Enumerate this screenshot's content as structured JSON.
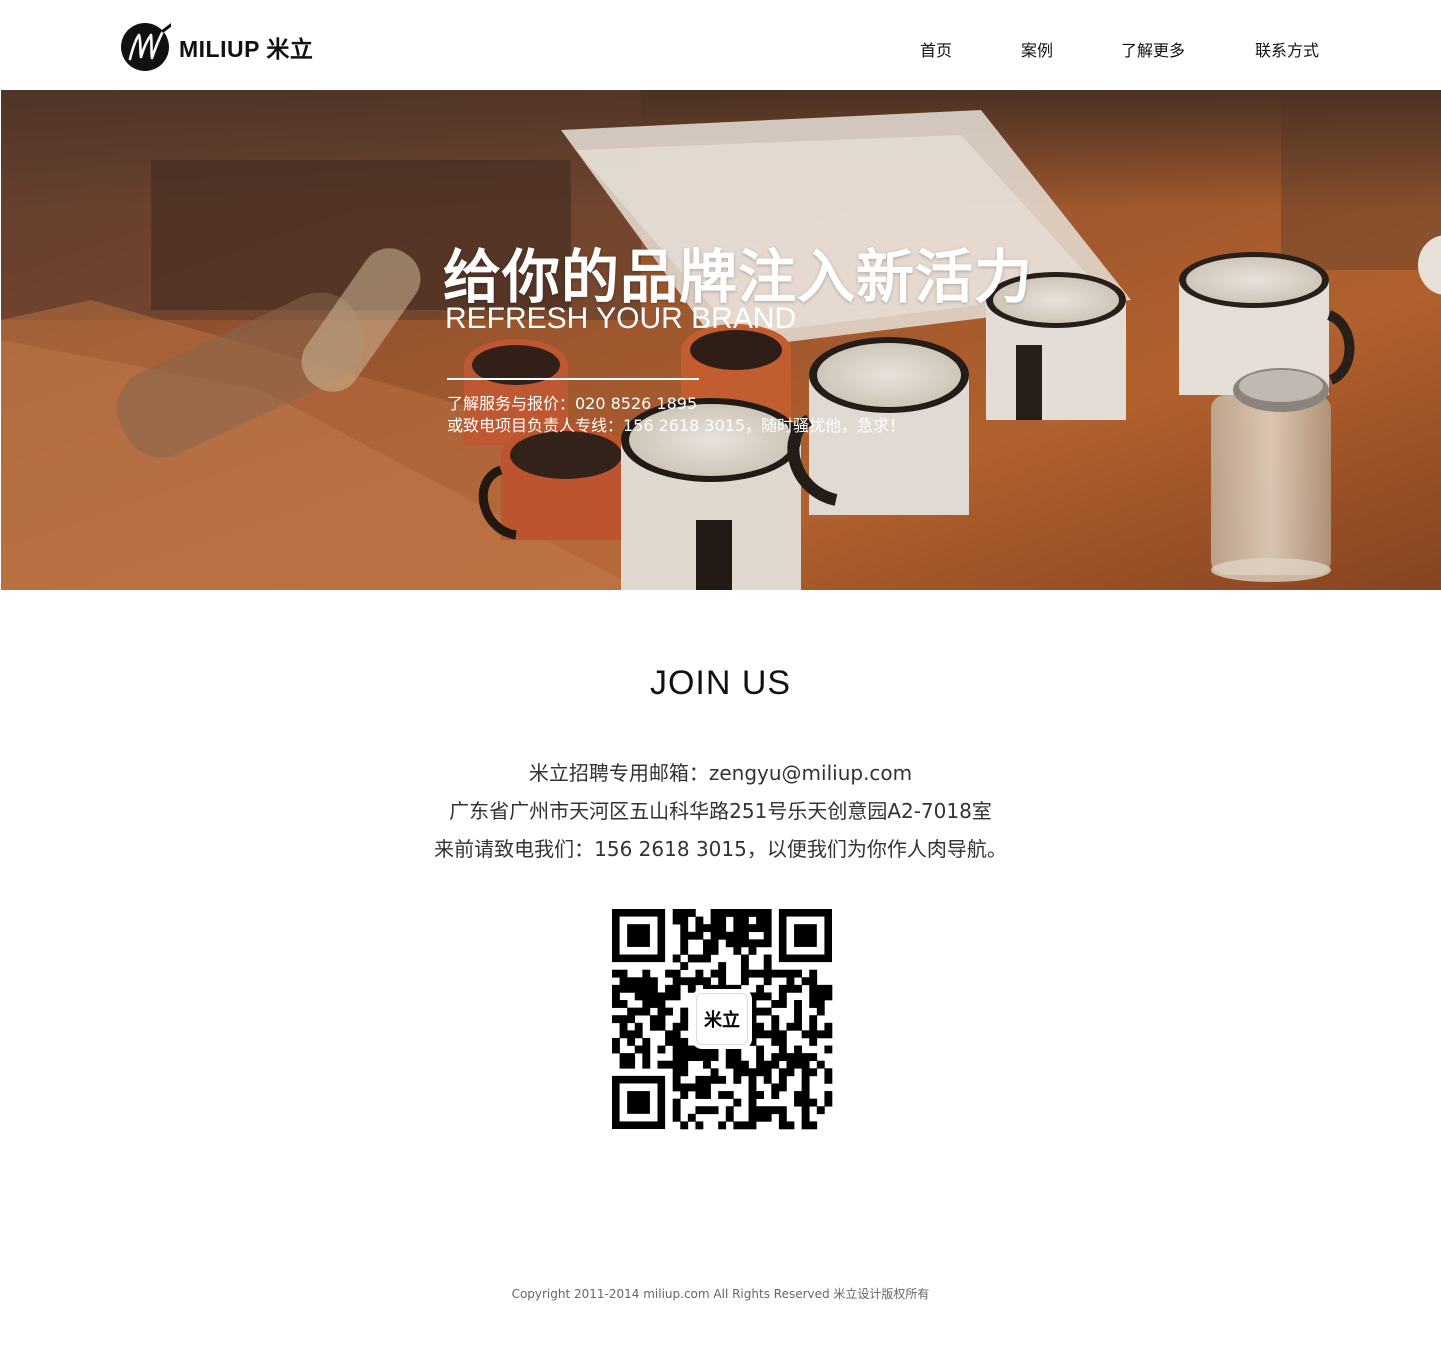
{
  "header": {
    "logo_text": "MILIUP 米立",
    "nav": [
      {
        "label": "首页"
      },
      {
        "label": "案例"
      },
      {
        "label": "了解更多"
      },
      {
        "label": "联系方式"
      }
    ]
  },
  "hero": {
    "title": "给你的品牌注入新活力",
    "subtitle": "REFRESH YOUR BRAND",
    "info_line1": "了解服务与报价：020 8526 1895",
    "info_line2": "或致电项目负责人专线：156 2618 3015，随时骚扰他，急求！"
  },
  "join": {
    "title": "JOIN US",
    "line1": "米立招聘专用邮箱：zengyu@miliup.com",
    "line2": "广东省广州市天河区五山科华路251号乐天创意园A2-7018室",
    "line3": "来前请致电我们：156 2618 3015，以便我们为你作人肉导航。",
    "qr_label": "米立"
  },
  "footer": {
    "copyright": "Copyright 2011-2014 miliup.com All Rights Reserved 米立设计版权所有"
  },
  "colors": {
    "text": "#111111",
    "hero_wood": "#a5552a",
    "background": "#ffffff"
  }
}
